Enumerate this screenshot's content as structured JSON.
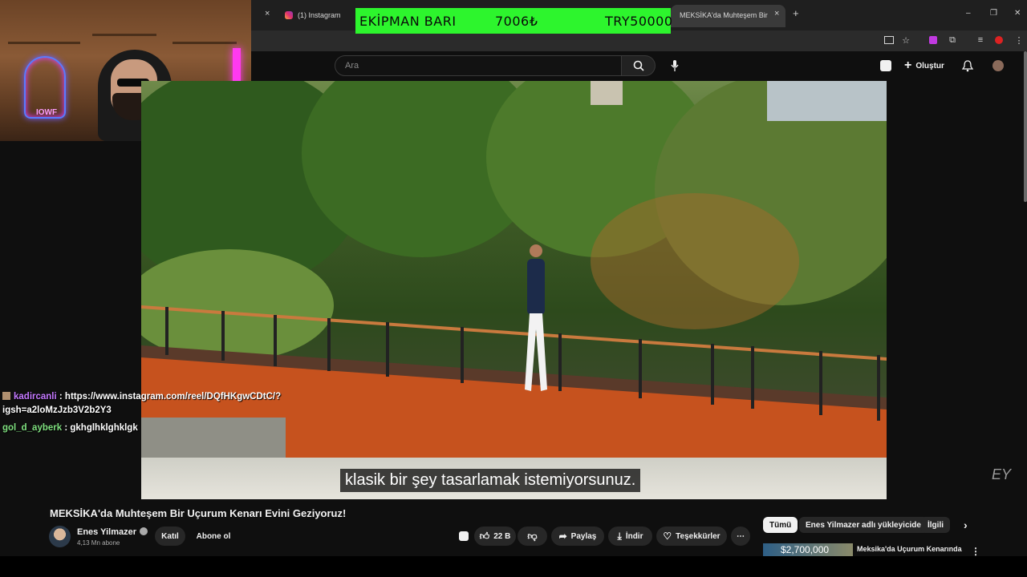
{
  "browser": {
    "tabs": [
      {
        "label": "(1) Instagram",
        "icon": "instagram-icon"
      },
      {
        "label": "MEKSİKA'da Muhteşem Bir Uçur",
        "icon": "youtube-icon"
      }
    ],
    "new_tab": "+",
    "close": "×",
    "window_controls": {
      "minimize": "–",
      "maximize": "❐",
      "close": "✕"
    }
  },
  "banner": {
    "label": "EKİPMAN BARI",
    "current": "7006₺",
    "goal": "TRY50000",
    "color": "#2df52d"
  },
  "webcam": {
    "neon_text": "IOWF"
  },
  "youtube": {
    "search_placeholder": "Ara",
    "create_label": "Oluştur",
    "video": {
      "subtitle": "klasik bir şey tasarlamak istemiyorsunuz.",
      "watermark": "EY",
      "title": "MEKSİKA'da Muhteşem Bir Uçurum Kenarı Evini Geziyoruz!"
    },
    "channel": {
      "name": "Enes Yilmazer",
      "subscribers": "4,13 Mn abone"
    },
    "buttons": {
      "join": "Katıl",
      "subscribe": "Abone ol",
      "likes": "22 B",
      "share": "Paylaş",
      "download": "İndir",
      "thanks": "Teşekkürler",
      "more": "⋯"
    },
    "chips": [
      "Tümü",
      "Enes Yilmazer adlı yükleyiciden",
      "İlgili"
    ],
    "recommendation": {
      "thumb_text": "$2,700,000",
      "title": "Meksika'da Uçurum Kenarında"
    }
  },
  "chat": [
    {
      "user": "kadircanli",
      "message": ": https://www.instagram.com/reel/DQfHKgwCDtC/?igsh=a2loMzJzb3V2b2Y3"
    },
    {
      "user": "gol_d_ayberk",
      "message": ": gkhglhklghklgk"
    }
  ]
}
